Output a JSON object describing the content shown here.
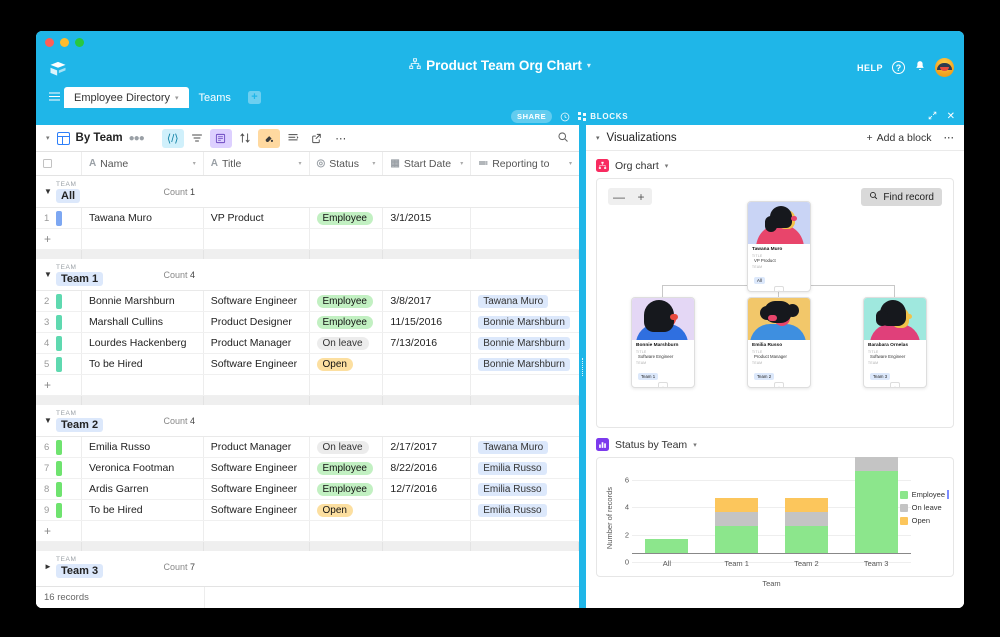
{
  "window": {
    "traffic_lights": [
      "close",
      "minimize",
      "maximize"
    ]
  },
  "header": {
    "app_logo": "airtable-logo-icon",
    "title": "Product Team Org Chart",
    "title_icon": "org-chart-icon",
    "title_caret": "▾",
    "help_label": "HELP",
    "help_icon": "question-circle-icon",
    "bell_icon": "bell-icon",
    "avatar": "user-avatar"
  },
  "tabs": {
    "hamburger": "menu-icon",
    "items": [
      {
        "label": "Employee Directory",
        "active": true,
        "caret": "▾"
      },
      {
        "label": "Teams",
        "active": false,
        "caret": ""
      }
    ],
    "add_label": "+"
  },
  "subbar": {
    "share_label": "SHARE",
    "history_icon": "clock-icon",
    "blocks_label": "BLOCKS",
    "expand_icon": "expand-icon",
    "close_icon": "close-icon"
  },
  "viewbar": {
    "caret": "▾",
    "view_name": "By Team",
    "collaborators_icon": "collaborators-icon",
    "buttons": [
      {
        "name": "hide-fields-button",
        "glyph": "⟨/⟩",
        "style": "bg-blue"
      },
      {
        "name": "filter-button",
        "glyph": "≡",
        "style": ""
      },
      {
        "name": "group-button",
        "glyph": "▤",
        "style": "bg-purple"
      },
      {
        "name": "sort-button",
        "glyph": "↓↑",
        "style": ""
      },
      {
        "name": "color-button",
        "glyph": "◗",
        "style": "bg-orange"
      },
      {
        "name": "row-height-button",
        "glyph": "≣",
        "style": ""
      },
      {
        "name": "share-view-button",
        "glyph": "↗",
        "style": ""
      },
      {
        "name": "more-options-button",
        "glyph": "⋯",
        "style": ""
      }
    ],
    "search_icon": "search-icon"
  },
  "grid": {
    "columns": [
      {
        "key": "idx",
        "label": "",
        "type_icon": ""
      },
      {
        "key": "name",
        "label": "Name",
        "type_icon": "A"
      },
      {
        "key": "title",
        "label": "Title",
        "type_icon": "A"
      },
      {
        "key": "status",
        "label": "Status",
        "type_icon": "◎"
      },
      {
        "key": "date",
        "label": "Start Date",
        "type_icon": "▦"
      },
      {
        "key": "report",
        "label": "Reporting to",
        "type_icon": "≕"
      }
    ],
    "group_key_label": "TEAM",
    "count_label": "Count",
    "groups": [
      {
        "value": "All",
        "count": "1",
        "expanded": true,
        "rows": [
          {
            "idx": "1",
            "color": "#7da7f2",
            "name": "Tawana Muro",
            "title": "VP Product",
            "status": "Employee",
            "status_style": "pill-green",
            "date": "3/1/2015",
            "report": ""
          }
        ]
      },
      {
        "value": "Team 1",
        "count": "4",
        "expanded": true,
        "rows": [
          {
            "idx": "2",
            "color": "#5fd9b0",
            "name": "Bonnie Marshburn",
            "title": "Software Engineer",
            "status": "Employee",
            "status_style": "pill-green",
            "date": "3/8/2017",
            "report": "Tawana Muro"
          },
          {
            "idx": "3",
            "color": "#5fd9b0",
            "name": "Marshall Cullins",
            "title": "Product Designer",
            "status": "Employee",
            "status_style": "pill-green",
            "date": "11/15/2016",
            "report": "Bonnie Marshburn"
          },
          {
            "idx": "4",
            "color": "#5fd9b0",
            "name": "Lourdes Hackenberg",
            "title": "Product Manager",
            "status": "On leave",
            "status_style": "pill-gray",
            "date": "7/13/2016",
            "report": "Bonnie Marshburn"
          },
          {
            "idx": "5",
            "color": "#5fd9b0",
            "name": "To be Hired",
            "title": "Software Engineer",
            "status": "Open",
            "status_style": "pill-orange",
            "date": "",
            "report": "Bonnie Marshburn"
          }
        ]
      },
      {
        "value": "Team 2",
        "count": "4",
        "expanded": true,
        "rows": [
          {
            "idx": "6",
            "color": "#6fe36f",
            "name": "Emilia Russo",
            "title": "Product Manager",
            "status": "On leave",
            "status_style": "pill-gray",
            "date": "2/17/2017",
            "report": "Tawana Muro"
          },
          {
            "idx": "7",
            "color": "#6fe36f",
            "name": "Veronica Footman",
            "title": "Software Engineer",
            "status": "Employee",
            "status_style": "pill-green",
            "date": "8/22/2016",
            "report": "Emilia Russo"
          },
          {
            "idx": "8",
            "color": "#6fe36f",
            "name": "Ardis Garren",
            "title": "Software Engineer",
            "status": "Employee",
            "status_style": "pill-green",
            "date": "12/7/2016",
            "report": "Emilia Russo"
          },
          {
            "idx": "9",
            "color": "#6fe36f",
            "name": "To be Hired",
            "title": "Software Engineer",
            "status": "Open",
            "status_style": "pill-orange",
            "date": "",
            "report": "Emilia Russo"
          }
        ]
      },
      {
        "value": "Team 3",
        "count": "7",
        "expanded": false,
        "rows": []
      }
    ],
    "add_row_glyph": "+",
    "record_count": "16 records"
  },
  "blocks": {
    "panel_caret": "▾",
    "panel_title": "Visualizations",
    "add_block_label": "Add a block",
    "add_block_plus": "+",
    "more_glyph": "⋯",
    "org_chart": {
      "icon": "org-chart-block-icon",
      "label": "Org chart",
      "caret": "▾",
      "zoom_out": "—",
      "zoom_in": "+",
      "find_record_label": "Find record",
      "find_record_icon": "search-icon",
      "key_title": "TITLE",
      "key_team": "TEAM",
      "expander_glyph": "⌄",
      "root": {
        "name": "Tawana Muro",
        "title": "VP Product",
        "team": "All"
      },
      "children": [
        {
          "name": "Bonnie Marshburn",
          "title": "Software Engineer",
          "team": "Team 1"
        },
        {
          "name": "Emilia Russo",
          "title": "Product Manager",
          "team": "Team 2"
        },
        {
          "name": "Barabara Ornelas",
          "title": "Software Engineer",
          "team": "Team 3"
        }
      ]
    },
    "status_chart": {
      "icon": "bar-chart-block-icon",
      "label": "Status by Team",
      "caret": "▾"
    }
  },
  "chart_data": {
    "type": "bar",
    "title": "Status by Team",
    "stacked": true,
    "categories": [
      "All",
      "Team 1",
      "Team 2",
      "Team 3"
    ],
    "series": [
      {
        "name": "Employee",
        "color": "#8ce68c",
        "values": [
          1,
          2,
          2,
          6
        ]
      },
      {
        "name": "On leave",
        "color": "#c4c4c4",
        "values": [
          0,
          1,
          1,
          1
        ]
      },
      {
        "name": "Open",
        "color": "#fcc köz",
        "values": [
          0,
          1,
          1,
          0
        ]
      }
    ],
    "xlabel": "Team",
    "ylabel": "Number of records",
    "ylim": [
      0,
      7
    ],
    "yticks": [
      0,
      2,
      4,
      6
    ],
    "grid": true,
    "legend_position": "right"
  }
}
